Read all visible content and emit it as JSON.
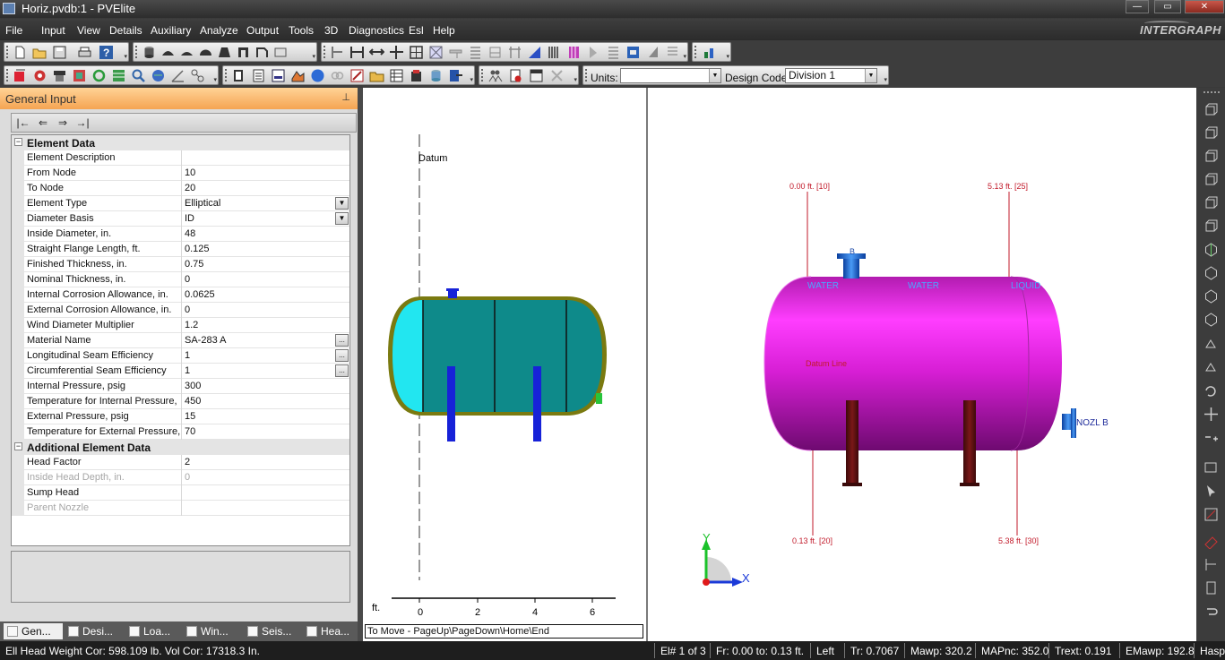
{
  "window": {
    "title": "Horiz.pvdb:1 - PVElite",
    "minimize": "—",
    "maximize": "▭",
    "close": "✕"
  },
  "menu": [
    "File",
    "Input",
    "View",
    "Details",
    "Auxiliary",
    "Analyze",
    "Output",
    "Tools",
    "3D",
    "Diagnostics",
    "Esl",
    "Help"
  ],
  "brand": "INTERGRAPH",
  "toolbar": {
    "units_label": "Units:",
    "units_value": "",
    "design_code_label": "Design Code:",
    "design_code_value": "Division 1"
  },
  "panel": {
    "title": "General Input",
    "nav_buttons": [
      "|←",
      "⇐",
      "⇒",
      "→|"
    ],
    "sections": [
      {
        "title": "Element Data",
        "rows": [
          {
            "label": "Element Description",
            "value": "",
            "disabled": false,
            "btn": ""
          },
          {
            "label": "From Node",
            "value": "10",
            "disabled": false,
            "btn": ""
          },
          {
            "label": "To Node",
            "value": "20",
            "disabled": false,
            "btn": ""
          },
          {
            "label": "Element Type",
            "value": "Elliptical",
            "disabled": false,
            "btn": "▼"
          },
          {
            "label": "Diameter Basis",
            "value": "ID",
            "disabled": false,
            "btn": "▼"
          },
          {
            "label": "Inside Diameter, in.",
            "value": "48",
            "disabled": false,
            "btn": ""
          },
          {
            "label": "Straight Flange Length, ft.",
            "value": "0.125",
            "disabled": false,
            "btn": ""
          },
          {
            "label": "Finished Thickness, in.",
            "value": "0.75",
            "disabled": false,
            "btn": ""
          },
          {
            "label": "Nominal Thickness,  in.",
            "value": "0",
            "disabled": false,
            "btn": ""
          },
          {
            "label": "Internal Corrosion Allowance,  in.",
            "value": "0.0625",
            "disabled": false,
            "btn": ""
          },
          {
            "label": "External Corrosion Allowance,  in.",
            "value": "0",
            "disabled": false,
            "btn": ""
          },
          {
            "label": "Wind Diameter Multiplier",
            "value": "1.2",
            "disabled": false,
            "btn": ""
          },
          {
            "label": "Material Name",
            "value": "SA-283 A",
            "disabled": false,
            "btn": "..."
          },
          {
            "label": "Longitudinal Seam Efficiency",
            "value": "1",
            "disabled": false,
            "btn": "..."
          },
          {
            "label": "Circumferential Seam Efficiency",
            "value": "1",
            "disabled": false,
            "btn": "..."
          },
          {
            "label": "Internal Pressure,  psig",
            "value": "300",
            "disabled": false,
            "btn": ""
          },
          {
            "label": "Temperature for Internal Pressure,",
            "value": "450",
            "disabled": false,
            "btn": ""
          },
          {
            "label": "External Pressure,  psig",
            "value": "15",
            "disabled": false,
            "btn": ""
          },
          {
            "label": "Temperature for External Pressure,",
            "value": "70",
            "disabled": false,
            "btn": ""
          }
        ]
      },
      {
        "title": "Additional Element Data",
        "rows": [
          {
            "label": "Head Factor",
            "value": "2",
            "disabled": false,
            "btn": ""
          },
          {
            "label": "Inside Head Depth, in.",
            "value": "0",
            "disabled": true,
            "btn": ""
          },
          {
            "label": "Sump Head",
            "value": "",
            "disabled": false,
            "btn": ""
          },
          {
            "label": "Parent Nozzle",
            "value": "",
            "disabled": true,
            "btn": ""
          }
        ]
      }
    ],
    "tabs": [
      "Gen...",
      "Desi...",
      "Loa...",
      "Win...",
      "Seis...",
      "Hea..."
    ]
  },
  "view2d": {
    "datum": "Datum",
    "unit": "ft.",
    "ticks": [
      "0",
      "2",
      "4",
      "6"
    ],
    "hint": "To Move - PageUp\\PageDown\\Home\\End"
  },
  "view3d": {
    "labels": {
      "l10": "0.00 ft.   [10]",
      "l25": "5.13 ft.   [25]",
      "l20": "0.13 ft.   [20]",
      "l30": "5.38 ft.   [30]",
      "water1": "WATER",
      "water2": "WATER",
      "liquid": "LIQUID",
      "datum_line": "Datum Line",
      "nozzle": "NOZL B",
      "nozzle_top": "B"
    },
    "axes": {
      "x": "X",
      "y": "Y"
    }
  },
  "status": {
    "left": "Ell Head Weight Cor: 598.109 lb.  Vol Cor: 17318.3 In.",
    "cells": [
      "El# 1 of 3",
      "Fr: 0.00 to: 0.13 ft.",
      "Left",
      "Tr: 0.7067",
      "Mawp: 320.2",
      "MAPnc: 352.0",
      "Trext: 0.191",
      "EMawp: 192.8",
      "Hasp"
    ]
  }
}
